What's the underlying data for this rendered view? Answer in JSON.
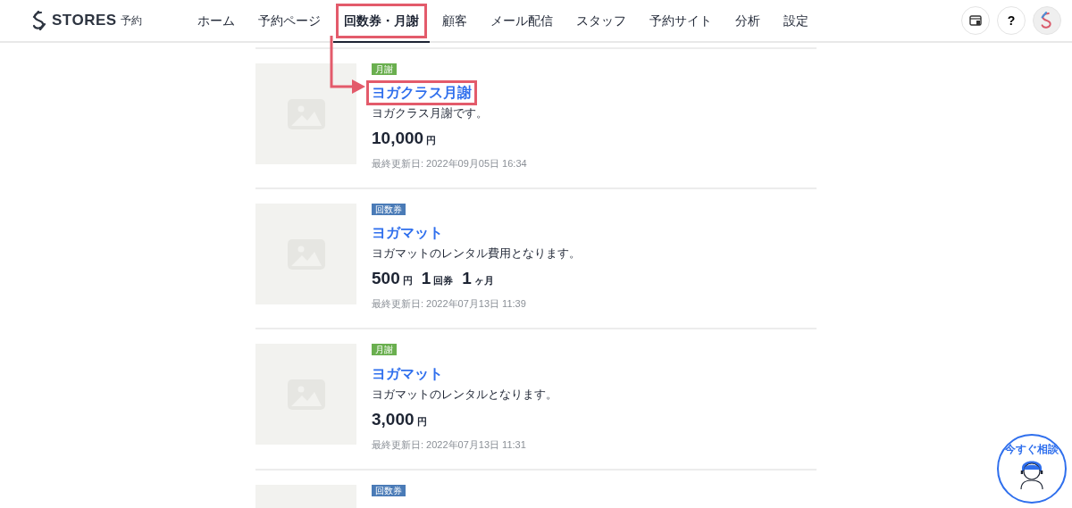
{
  "header": {
    "logo_text": "STORES",
    "logo_sub": "予約",
    "nav": [
      {
        "label": "ホーム",
        "selected": false,
        "highlighted": false
      },
      {
        "label": "予約ページ",
        "selected": false,
        "highlighted": false
      },
      {
        "label": "回数券・月謝",
        "selected": true,
        "highlighted": true
      },
      {
        "label": "顧客",
        "selected": false,
        "highlighted": false
      },
      {
        "label": "メール配信",
        "selected": false,
        "highlighted": false
      },
      {
        "label": "スタッフ",
        "selected": false,
        "highlighted": false
      },
      {
        "label": "予約サイト",
        "selected": false,
        "highlighted": false
      },
      {
        "label": "分析",
        "selected": false,
        "highlighted": false
      },
      {
        "label": "設定",
        "selected": false,
        "highlighted": false
      }
    ],
    "help_label": "?"
  },
  "products": [
    {
      "tag": "月謝",
      "color": "#6aaf4f",
      "title": "ヨガクラス月謝",
      "highlighted": true,
      "description": "ヨガクラス月謝です。",
      "price": [
        {
          "amount": "10,000",
          "unit": "円"
        }
      ],
      "updated": "最終更新日: 2022年09月05日 16:34"
    },
    {
      "tag": "回数券",
      "color": "#4a7bb7",
      "title": "ヨガマット",
      "highlighted": false,
      "description": "ヨガマットのレンタル費用となります。",
      "price": [
        {
          "amount": "500",
          "unit": "円"
        },
        {
          "amount": "1",
          "unit": "回券"
        },
        {
          "amount": "1",
          "unit": "ヶ月"
        }
      ],
      "updated": "最終更新日: 2022年07月13日 11:39"
    },
    {
      "tag": "月謝",
      "color": "#6aaf4f",
      "title": "ヨガマット",
      "highlighted": false,
      "description": "ヨガマットのレンタルとなります。",
      "price": [
        {
          "amount": "3,000",
          "unit": "円"
        }
      ],
      "updated": "最終更新日: 2022年07月13日 11:31"
    },
    {
      "tag": "回数券",
      "color": "#4a7bb7"
    }
  ],
  "chat_button": {
    "label": "今すぐ相談"
  }
}
